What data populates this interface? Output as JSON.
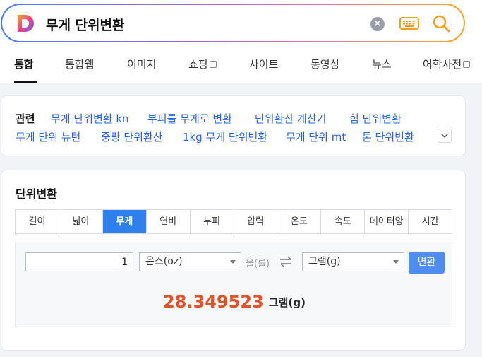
{
  "search": {
    "query": "무게 단위변환",
    "logo_icon": "daum-logo-icon"
  },
  "tabs": [
    {
      "label": "통합",
      "active": true
    },
    {
      "label": "통합웹"
    },
    {
      "label": "이미지"
    },
    {
      "label": "쇼핑"
    },
    {
      "label": "사이트"
    },
    {
      "label": "동영상"
    },
    {
      "label": "뉴스"
    },
    {
      "label": "어학사전"
    }
  ],
  "related": {
    "title": "관련",
    "links": [
      "무게 단위변환 kn",
      "부피를 무게로 변환",
      "단위환산 계산기",
      "힘 단위변환",
      "무게 단위 뉴턴",
      "중량 단위환산",
      "1kg 무게 단위변환",
      "무게 단위 mt",
      "톤 단위변환"
    ]
  },
  "converter": {
    "title": "단위변환",
    "unit_tabs": [
      "길이",
      "넓이",
      "무게",
      "연비",
      "부피",
      "압력",
      "온도",
      "속도",
      "데이터양",
      "시간"
    ],
    "active_tab": "무게",
    "input_value": "1",
    "from_unit": "온스(oz)",
    "connector": "을(를)",
    "to_unit": "그램(g)",
    "convert_label": "변환",
    "result_value": "28.349523",
    "result_unit": "그램(g)"
  },
  "colors": {
    "accent": "#2f80ed",
    "link": "#2b63d9",
    "result": "#e0522a"
  }
}
